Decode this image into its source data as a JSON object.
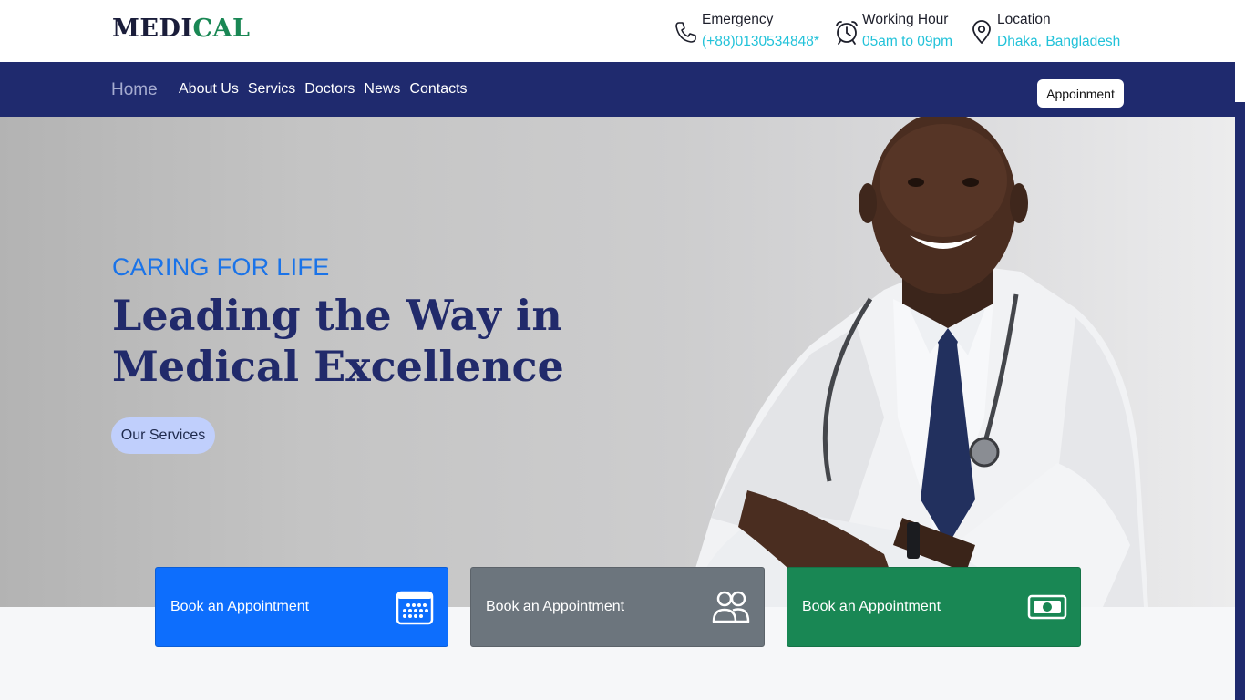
{
  "brand": {
    "part1": "MEDI",
    "part2": "CAL",
    "accent": "#198754",
    "dark": "#1a1d3a"
  },
  "contact": {
    "emergency": {
      "label": "Emergency",
      "value": "(+88)0130534848*",
      "icon": "phone-icon"
    },
    "hours": {
      "label": "Working Hour",
      "value": "05am to 09pm",
      "icon": "alarm-clock-icon"
    },
    "location": {
      "label": "Location",
      "value": "Dhaka, Bangladesh",
      "icon": "map-pin-icon"
    }
  },
  "nav": {
    "home": "Home",
    "links": [
      "About Us",
      "Servics",
      "Doctors",
      "News",
      "Contacts"
    ],
    "cta": "Appoinment",
    "background": "#1f2a6e"
  },
  "hero": {
    "tagline": "CARING FOR LIFE",
    "headline": "Leading the Way in Medical Excellence",
    "button": "Our Services"
  },
  "cards": [
    {
      "label": "Book an Appointment",
      "icon": "calendar-icon",
      "color": "#0d6efd"
    },
    {
      "label": "Book an Appointment",
      "icon": "people-icon",
      "color": "#6c757d"
    },
    {
      "label": "Book an Appointment",
      "icon": "cash-icon",
      "color": "#198754"
    }
  ]
}
